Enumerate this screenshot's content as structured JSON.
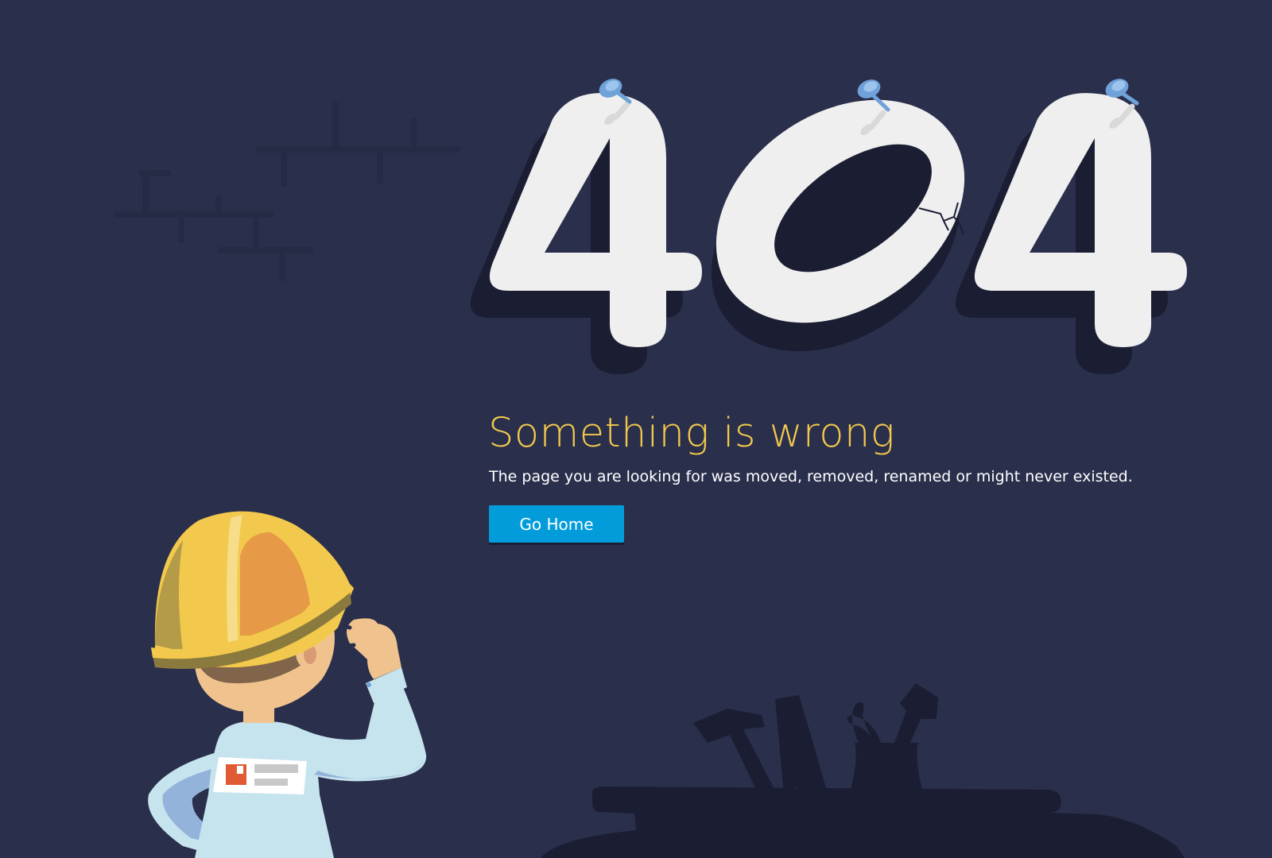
{
  "error": {
    "code": "404"
  },
  "message": {
    "title": "Something is wrong",
    "description": "The page you are looking for was moved, removed, renamed or might never existed."
  },
  "actions": {
    "home_label": "Go Home"
  },
  "colors": {
    "background": "#2a2f4c",
    "shadow": "#1b1e33",
    "digit_fill": "#efefef",
    "title": "#f2c94c",
    "button": "#039cdb",
    "helmet": "#f2c94c",
    "shirt": "#c6e4ee"
  },
  "icons": {
    "pins": "push-pin-icon",
    "tools": [
      "hammer-icon",
      "saw-icon",
      "pliers-icon",
      "brush-icon"
    ]
  }
}
